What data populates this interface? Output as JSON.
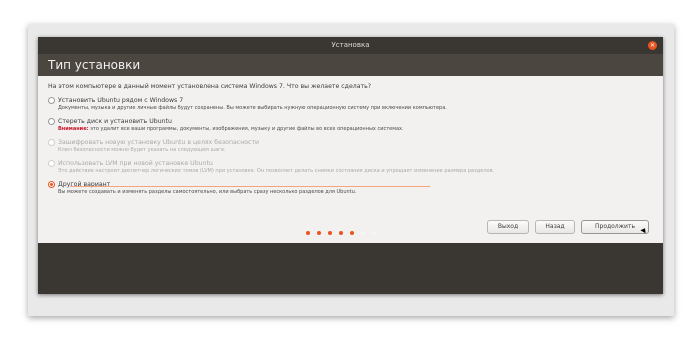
{
  "window": {
    "title": "Установка"
  },
  "header": {
    "title": "Тип установки"
  },
  "question": "На этом компьютере в данный момент установлена система Windows 7. Что вы желаете сделать?",
  "options": [
    {
      "title": "Установить Ubuntu рядом с Windows 7",
      "desc": "Документы, музыка и другие личные файлы будут сохранены. Вы можете выбирать нужную операционную систему при включении компьютера."
    },
    {
      "title": "Стереть диск и установить Ubuntu",
      "warn": "Внимание:",
      "desc": "это удалит все ваши программы, документы, изображения, музыку и другие файлы во всех операционных системах."
    },
    {
      "title": "Зашифровать новую установку Ubuntu в целях безопасности",
      "desc": "Ключ безопасности можно будет указать на следующем шаге."
    },
    {
      "title": "Использовать LVM при новой установке Ubuntu",
      "desc": "Это действие настроит диспетчер логических томов (LVM) при установке. Он позволяет делать снимки состояния диска и упрощает изменение размера разделов."
    },
    {
      "title": "Другой вариант",
      "desc": "Вы можете создавать и изменять разделы самостоятельно, или выбрать сразу несколько разделов для Ubuntu."
    }
  ],
  "buttons": {
    "quit": "Выход",
    "back": "Назад",
    "next": "Продолжить"
  },
  "progress": {
    "done": 5,
    "total": 7
  },
  "colors": {
    "accent": "#e95420",
    "window_bg": "#3a3631",
    "content_bg": "#f2f1f0"
  }
}
